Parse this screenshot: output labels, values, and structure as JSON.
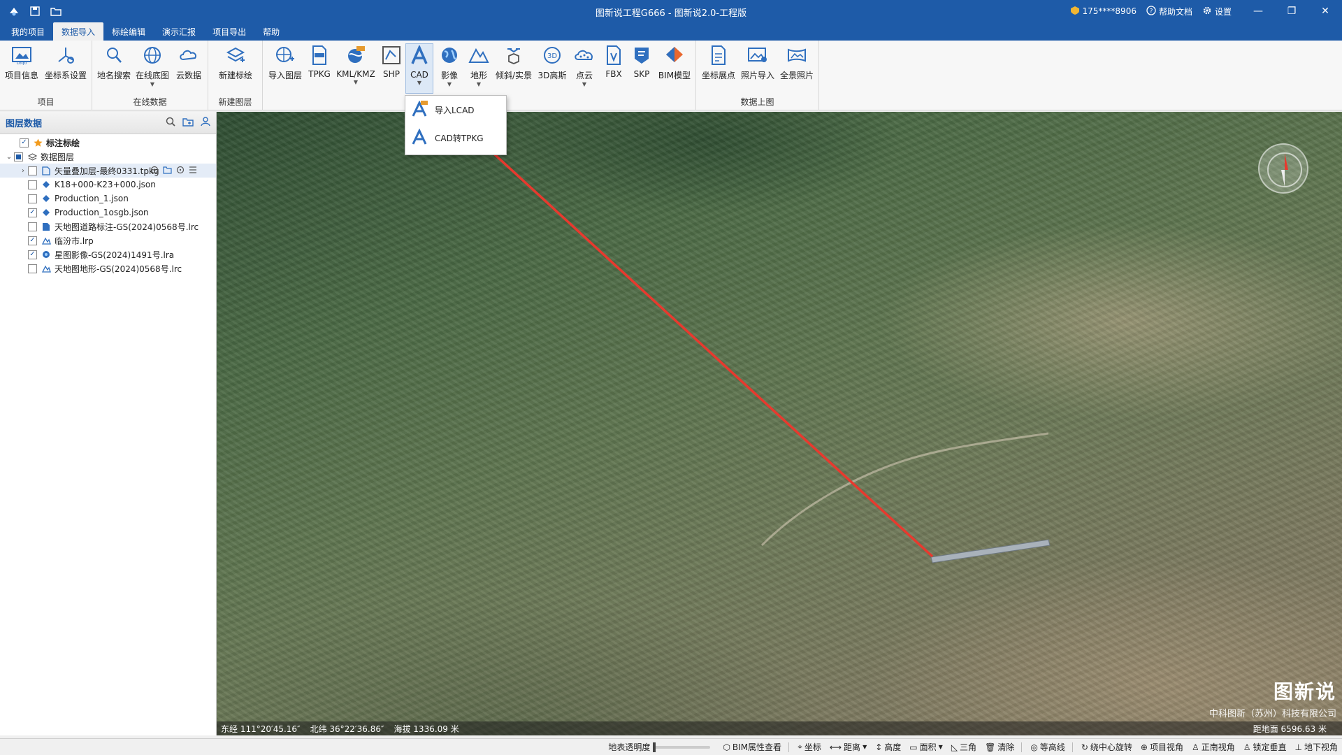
{
  "window": {
    "title": "图新说工程G666 - 图新说2.0-工程版",
    "user": "175****8906",
    "help_label": "帮助文档",
    "settings_label": "设置"
  },
  "menu": {
    "tabs": [
      {
        "label": "我的项目"
      },
      {
        "label": "数据导入"
      },
      {
        "label": "标绘编辑"
      },
      {
        "label": "演示汇报"
      },
      {
        "label": "项目导出"
      },
      {
        "label": "帮助"
      }
    ]
  },
  "ribbon": {
    "groups": {
      "project": {
        "label": "项目",
        "items": [
          "项目信息",
          "坐标系设置"
        ]
      },
      "online": {
        "label": "在线数据",
        "items": [
          "地名搜索",
          "在线底图",
          "云数据"
        ]
      },
      "newlayer": {
        "label": "新建图层",
        "items": [
          "新建标绘"
        ]
      },
      "import": {
        "items": [
          "导入图层",
          "TPKG",
          "KML/KMZ",
          "SHP",
          "CAD",
          "影像",
          "地形",
          "倾斜/实景",
          "3D高斯",
          "点云",
          "FBX",
          "SKP",
          "BIM模型"
        ]
      },
      "upload": {
        "label": "数据上图",
        "items": [
          "坐标展点",
          "照片导入",
          "全景照片"
        ]
      }
    }
  },
  "cad_dropdown": {
    "items": [
      {
        "label": "导入LCAD"
      },
      {
        "label": "CAD转TPKG"
      }
    ]
  },
  "layer_panel": {
    "title": "图层数据",
    "tree": [
      {
        "label": "标注标绘",
        "checked": true,
        "level": 0
      },
      {
        "label": "数据图层",
        "checked": "partial",
        "level": 0
      },
      {
        "label": "矢量叠加层-最终0331.tpkg",
        "checked": false,
        "level": 1
      },
      {
        "label": "K18+000-K23+000.json",
        "checked": false,
        "level": 1
      },
      {
        "label": "Production_1.json",
        "checked": false,
        "level": 1
      },
      {
        "label": "Production_1osgb.json",
        "checked": true,
        "level": 1
      },
      {
        "label": "天地图道路标注-GS(2024)0568号.lrc",
        "checked": false,
        "level": 1
      },
      {
        "label": "临汾市.lrp",
        "checked": true,
        "level": 1
      },
      {
        "label": "星图影像-GS(2024)1491号.lra",
        "checked": true,
        "level": 1
      },
      {
        "label": "天地图地形-GS(2024)0568号.lrc",
        "checked": false,
        "level": 1
      }
    ]
  },
  "map": {
    "brand": "图新说",
    "company": "中科图新（苏州）科技有限公司",
    "arrow_color": "#e8392e"
  },
  "coords": {
    "lon": "东经 111°20′45.16″",
    "lat": "北纬 36°22′36.86″",
    "alt": "海拔 1336.09 米",
    "dist": "距地面 6596.63 米"
  },
  "statusbar": {
    "opacity_label": "地表透明度",
    "items": [
      "BIM属性查看",
      "坐标",
      "距离",
      "高度",
      "面积",
      "三角",
      "清除",
      "等高线",
      "绕中心旋转",
      "项目视角",
      "正南视角",
      "锁定垂直",
      "地下视角"
    ]
  }
}
